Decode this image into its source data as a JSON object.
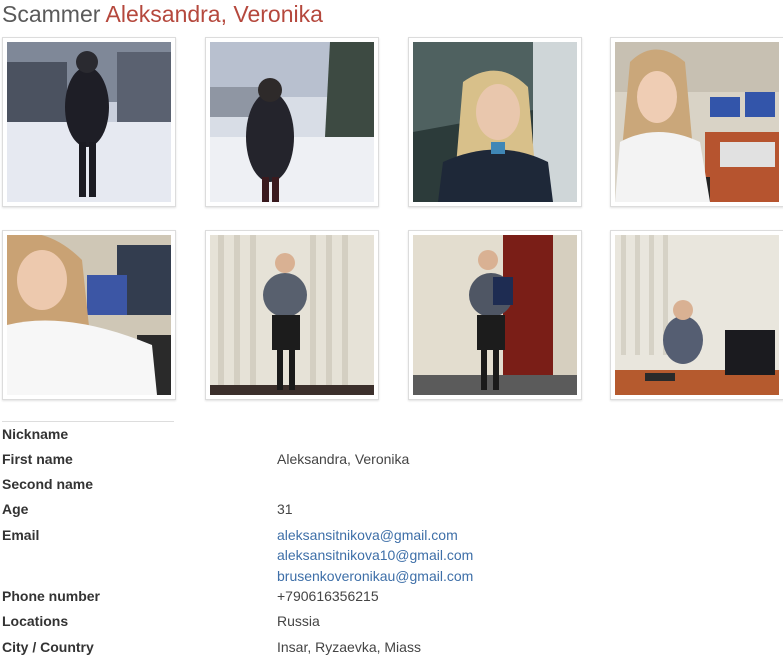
{
  "page": {
    "title_prefix": "Scammer",
    "title_name": "Aleksandra, Veronika"
  },
  "photos": [
    {
      "alt": "photo-1"
    },
    {
      "alt": "photo-2"
    },
    {
      "alt": "photo-3"
    },
    {
      "alt": "photo-4"
    },
    {
      "alt": "photo-5"
    },
    {
      "alt": "photo-6"
    },
    {
      "alt": "photo-7"
    },
    {
      "alt": "photo-8"
    }
  ],
  "details": {
    "nickname_label": "Nickname",
    "nickname_value": "",
    "first_name_label": "First name",
    "first_name_value": "Aleksandra, Veronika",
    "second_name_label": "Second name",
    "second_name_value": "",
    "age_label": "Age",
    "age_value": "31",
    "email_label": "Email",
    "emails": [
      "aleksansitnikova@gmail.com",
      "aleksansitnikova10@gmail.com",
      "brusenkoveronikau@gmail.com"
    ],
    "phone_label": "Phone number",
    "phone_value": "+790616356215",
    "locations_label": "Locations",
    "locations_value": "Russia",
    "city_country_label": "City / Country",
    "city_country_value": "Insar, Ryzaevka, Miass"
  },
  "colors": {
    "accent": "#b5483d",
    "link": "#3e6fa8"
  }
}
